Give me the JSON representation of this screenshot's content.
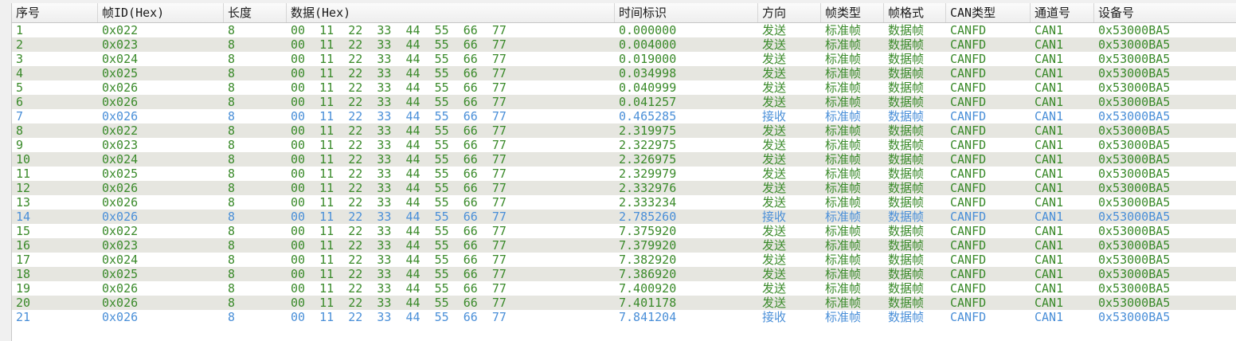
{
  "columns": [
    {
      "key": "seq",
      "label": "序号"
    },
    {
      "key": "id",
      "label": "帧ID(Hex)"
    },
    {
      "key": "len",
      "label": "长度"
    },
    {
      "key": "data",
      "label": "数据(Hex)"
    },
    {
      "key": "time",
      "label": "时间标识"
    },
    {
      "key": "dir",
      "label": "方向"
    },
    {
      "key": "ftype",
      "label": "帧类型"
    },
    {
      "key": "fformat",
      "label": "帧格式"
    },
    {
      "key": "can",
      "label": "CAN类型"
    },
    {
      "key": "ch",
      "label": "通道号"
    },
    {
      "key": "dev",
      "label": "设备号"
    }
  ],
  "colors": {
    "send": "#3a8a2a",
    "recv": "#4a8fd8",
    "alt_row": "#e6e6e0"
  },
  "rows": [
    {
      "seq": "1",
      "id": "0x022",
      "len": "8",
      "data": "00  11  22  33  44  55  66  77",
      "time": "0.000000",
      "dir": "发送",
      "ftype": "标准帧",
      "fformat": "数据帧",
      "can": "CANFD",
      "ch": "CAN1",
      "dev": "0x53000BA5",
      "recv": false
    },
    {
      "seq": "2",
      "id": "0x023",
      "len": "8",
      "data": "00  11  22  33  44  55  66  77",
      "time": "0.004000",
      "dir": "发送",
      "ftype": "标准帧",
      "fformat": "数据帧",
      "can": "CANFD",
      "ch": "CAN1",
      "dev": "0x53000BA5",
      "recv": false
    },
    {
      "seq": "3",
      "id": "0x024",
      "len": "8",
      "data": "00  11  22  33  44  55  66  77",
      "time": "0.019000",
      "dir": "发送",
      "ftype": "标准帧",
      "fformat": "数据帧",
      "can": "CANFD",
      "ch": "CAN1",
      "dev": "0x53000BA5",
      "recv": false
    },
    {
      "seq": "4",
      "id": "0x025",
      "len": "8",
      "data": "00  11  22  33  44  55  66  77",
      "time": "0.034998",
      "dir": "发送",
      "ftype": "标准帧",
      "fformat": "数据帧",
      "can": "CANFD",
      "ch": "CAN1",
      "dev": "0x53000BA5",
      "recv": false
    },
    {
      "seq": "5",
      "id": "0x026",
      "len": "8",
      "data": "00  11  22  33  44  55  66  77",
      "time": "0.040999",
      "dir": "发送",
      "ftype": "标准帧",
      "fformat": "数据帧",
      "can": "CANFD",
      "ch": "CAN1",
      "dev": "0x53000BA5",
      "recv": false
    },
    {
      "seq": "6",
      "id": "0x026",
      "len": "8",
      "data": "00  11  22  33  44  55  66  77",
      "time": "0.041257",
      "dir": "发送",
      "ftype": "标准帧",
      "fformat": "数据帧",
      "can": "CANFD",
      "ch": "CAN1",
      "dev": "0x53000BA5",
      "recv": false
    },
    {
      "seq": "7",
      "id": "0x026",
      "len": "8",
      "data": "00  11  22  33  44  55  66  77",
      "time": "0.465285",
      "dir": "接收",
      "ftype": "标准帧",
      "fformat": "数据帧",
      "can": "CANFD",
      "ch": "CAN1",
      "dev": "0x53000BA5",
      "recv": true
    },
    {
      "seq": "8",
      "id": "0x022",
      "len": "8",
      "data": "00  11  22  33  44  55  66  77",
      "time": "2.319975",
      "dir": "发送",
      "ftype": "标准帧",
      "fformat": "数据帧",
      "can": "CANFD",
      "ch": "CAN1",
      "dev": "0x53000BA5",
      "recv": false
    },
    {
      "seq": "9",
      "id": "0x023",
      "len": "8",
      "data": "00  11  22  33  44  55  66  77",
      "time": "2.322975",
      "dir": "发送",
      "ftype": "标准帧",
      "fformat": "数据帧",
      "can": "CANFD",
      "ch": "CAN1",
      "dev": "0x53000BA5",
      "recv": false
    },
    {
      "seq": "10",
      "id": "0x024",
      "len": "8",
      "data": "00  11  22  33  44  55  66  77",
      "time": "2.326975",
      "dir": "发送",
      "ftype": "标准帧",
      "fformat": "数据帧",
      "can": "CANFD",
      "ch": "CAN1",
      "dev": "0x53000BA5",
      "recv": false
    },
    {
      "seq": "11",
      "id": "0x025",
      "len": "8",
      "data": "00  11  22  33  44  55  66  77",
      "time": "2.329979",
      "dir": "发送",
      "ftype": "标准帧",
      "fformat": "数据帧",
      "can": "CANFD",
      "ch": "CAN1",
      "dev": "0x53000BA5",
      "recv": false
    },
    {
      "seq": "12",
      "id": "0x026",
      "len": "8",
      "data": "00  11  22  33  44  55  66  77",
      "time": "2.332976",
      "dir": "发送",
      "ftype": "标准帧",
      "fformat": "数据帧",
      "can": "CANFD",
      "ch": "CAN1",
      "dev": "0x53000BA5",
      "recv": false
    },
    {
      "seq": "13",
      "id": "0x026",
      "len": "8",
      "data": "00  11  22  33  44  55  66  77",
      "time": "2.333234",
      "dir": "发送",
      "ftype": "标准帧",
      "fformat": "数据帧",
      "can": "CANFD",
      "ch": "CAN1",
      "dev": "0x53000BA5",
      "recv": false
    },
    {
      "seq": "14",
      "id": "0x026",
      "len": "8",
      "data": "00  11  22  33  44  55  66  77",
      "time": "2.785260",
      "dir": "接收",
      "ftype": "标准帧",
      "fformat": "数据帧",
      "can": "CANFD",
      "ch": "CAN1",
      "dev": "0x53000BA5",
      "recv": true
    },
    {
      "seq": "15",
      "id": "0x022",
      "len": "8",
      "data": "00  11  22  33  44  55  66  77",
      "time": "7.375920",
      "dir": "发送",
      "ftype": "标准帧",
      "fformat": "数据帧",
      "can": "CANFD",
      "ch": "CAN1",
      "dev": "0x53000BA5",
      "recv": false
    },
    {
      "seq": "16",
      "id": "0x023",
      "len": "8",
      "data": "00  11  22  33  44  55  66  77",
      "time": "7.379920",
      "dir": "发送",
      "ftype": "标准帧",
      "fformat": "数据帧",
      "can": "CANFD",
      "ch": "CAN1",
      "dev": "0x53000BA5",
      "recv": false
    },
    {
      "seq": "17",
      "id": "0x024",
      "len": "8",
      "data": "00  11  22  33  44  55  66  77",
      "time": "7.382920",
      "dir": "发送",
      "ftype": "标准帧",
      "fformat": "数据帧",
      "can": "CANFD",
      "ch": "CAN1",
      "dev": "0x53000BA5",
      "recv": false
    },
    {
      "seq": "18",
      "id": "0x025",
      "len": "8",
      "data": "00  11  22  33  44  55  66  77",
      "time": "7.386920",
      "dir": "发送",
      "ftype": "标准帧",
      "fformat": "数据帧",
      "can": "CANFD",
      "ch": "CAN1",
      "dev": "0x53000BA5",
      "recv": false
    },
    {
      "seq": "19",
      "id": "0x026",
      "len": "8",
      "data": "00  11  22  33  44  55  66  77",
      "time": "7.400920",
      "dir": "发送",
      "ftype": "标准帧",
      "fformat": "数据帧",
      "can": "CANFD",
      "ch": "CAN1",
      "dev": "0x53000BA5",
      "recv": false
    },
    {
      "seq": "20",
      "id": "0x026",
      "len": "8",
      "data": "00  11  22  33  44  55  66  77",
      "time": "7.401178",
      "dir": "发送",
      "ftype": "标准帧",
      "fformat": "数据帧",
      "can": "CANFD",
      "ch": "CAN1",
      "dev": "0x53000BA5",
      "recv": false
    },
    {
      "seq": "21",
      "id": "0x026",
      "len": "8",
      "data": "00  11  22  33  44  55  66  77",
      "time": "7.841204",
      "dir": "接收",
      "ftype": "标准帧",
      "fformat": "数据帧",
      "can": "CANFD",
      "ch": "CAN1",
      "dev": "0x53000BA5",
      "recv": true
    }
  ]
}
